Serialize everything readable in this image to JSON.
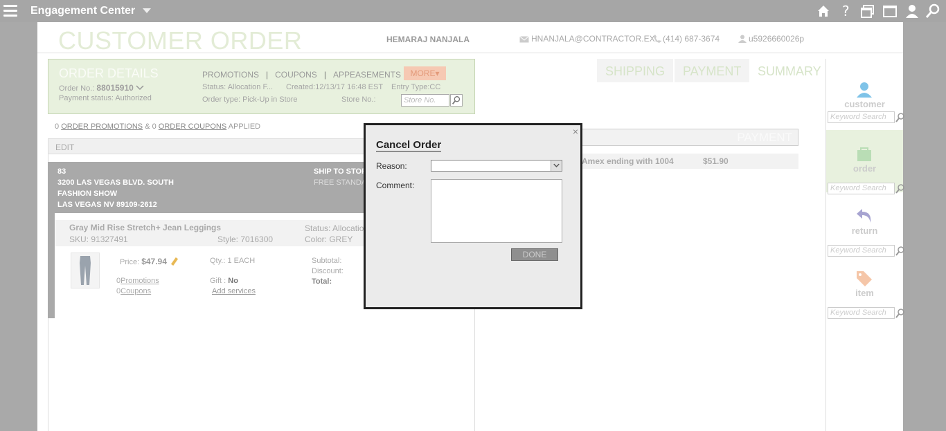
{
  "app": {
    "title": "Engagement Center"
  },
  "header": {
    "page_title": "CUSTOMER ORDER",
    "customer_name": "HEMARAJ NANJALA",
    "email": "HNANJALA@CONTRACTOR.EX...",
    "phone": "(414) 687-3674",
    "customer_id": "u5926660026p"
  },
  "order_details": {
    "title": "ORDER DETAILS",
    "order_no_label": "Order No.:",
    "order_no": "88015910",
    "payment_status": "Payment status: Authorized",
    "links": {
      "promotions": "PROMOTIONS",
      "coupons": "COUPONS",
      "appeasements": "APPEASEMENTS",
      "more": "MORE"
    },
    "status": "Status:  Allocation F...",
    "created": "Created:12/13/17 16:48 EST",
    "entry_type": "Entry Type:CC",
    "order_type": "Order type:  Pick-Up in Store",
    "store_no_label": "Store No.:",
    "store_no_placeholder": "Store No."
  },
  "applied": {
    "promo_count": "0",
    "promo_link": "ORDER PROMOTIONS",
    "amp": "&",
    "coupon_count": "0",
    "coupon_link": "ORDER COUPONS",
    "suffix": "APPLIED"
  },
  "edit_label": "EDIT",
  "shipment": {
    "address": [
      "83",
      "3200 LAS VEGAS BLVD. SOUTH",
      "FASHION SHOW",
      "LAS VEGAS NV 89109-2612"
    ],
    "ship_to": "SHIP TO STOR",
    "ship_method": "FREE STANDA"
  },
  "item": {
    "name": "Gray Mid Rise Stretch+ Jean Leggings",
    "sku": "SKU: 91327491",
    "style": "Style: 7016300",
    "status": "Status: Allocatio",
    "color": "Color: GREY",
    "price_label": "Price:",
    "price": "$47.94",
    "qty": "Qty.:  1  EACH",
    "promotions_count": "0",
    "promotions_link": "Promotions",
    "coupons_count": "0",
    "coupons_link": "Coupons",
    "gift_label": "Gift :",
    "gift_value": "No",
    "add_services": "Add services",
    "subtotal_label": "Subtotal:",
    "discount_label": "Discount:",
    "total_label": "Total:"
  },
  "tabs": [
    "SHIPPING",
    "PAYMENT",
    "SUMMARY"
  ],
  "payment": {
    "section_title": "PAYMENT",
    "method": "Amex ending with 1004",
    "amount": "$51.90"
  },
  "sidebar": {
    "sections": [
      {
        "label": "customer",
        "placeholder": "Keyword Search"
      },
      {
        "label": "order",
        "placeholder": "Keyword Search"
      },
      {
        "label": "return",
        "placeholder": "Keyword Search"
      },
      {
        "label": "item",
        "placeholder": "Keyword Search"
      }
    ]
  },
  "modal": {
    "title": "Cancel Order",
    "reason_label": "Reason:",
    "reason_value": "",
    "comment_label": "Comment:",
    "comment_value": "",
    "done_label": "DONE",
    "close_glyph": "×"
  },
  "colors": {
    "topbar": "#a6a6a6",
    "order_panel": "#e8f1de",
    "more_button": "#f6c9b3",
    "modal_border": "#222222"
  },
  "icons": [
    "menu-icon",
    "caret-down-icon",
    "home-icon",
    "help-icon",
    "windows-icon",
    "window-icon",
    "user-icon",
    "search-icon",
    "mail-icon",
    "phone-icon",
    "person-icon",
    "pencil-icon",
    "close-icon"
  ]
}
